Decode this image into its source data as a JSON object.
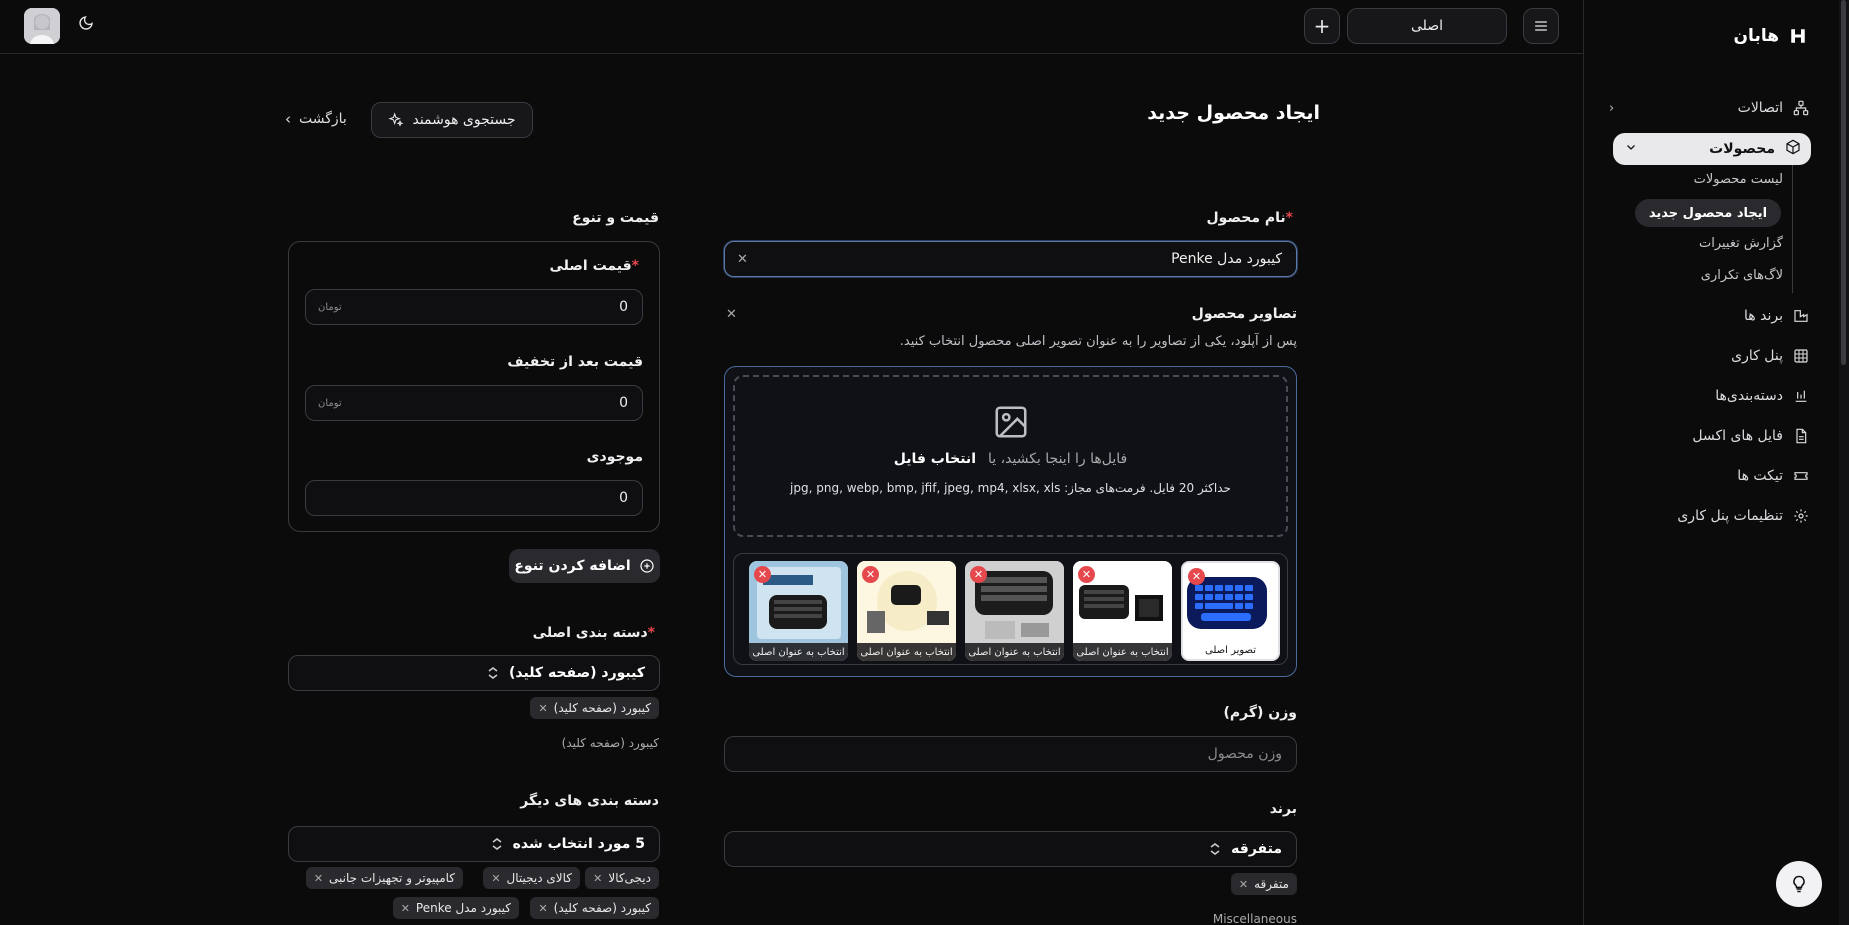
{
  "app": {
    "brand": "هابان"
  },
  "topbar": {
    "workspace": "اصلی"
  },
  "sidebar": {
    "items": [
      {
        "label": "اتصالات"
      },
      {
        "label": "محصولات"
      },
      {
        "label": "برند ها"
      },
      {
        "label": "پنل کاری"
      },
      {
        "label": "دسته‌بندی‌ها"
      },
      {
        "label": "فایل های اکسل"
      },
      {
        "label": "تیکت ها"
      },
      {
        "label": "تنظیمات پنل کاری"
      }
    ],
    "sub_items": [
      {
        "label": "لیست محصولات"
      },
      {
        "label": "ایجاد محصول جدید"
      },
      {
        "label": "گزارش تغییرات"
      },
      {
        "label": "لاگ‌های تکراری"
      }
    ]
  },
  "page": {
    "title": "ایجاد محصول جدید",
    "smart_search": "جستجوی هوشمند",
    "back": "بازگشت"
  },
  "product": {
    "name_label": "نام محصول",
    "name_value": "کیبورد مدل Penke",
    "images_label": "تصاویر محصول",
    "images_hint": "پس از آپلود، یکی از تصاویر را به عنوان تصویر اصلی محصول انتخاب کنید.",
    "drop_text": "فایل‌ها را اینجا بکشید، یا",
    "choose_file": "انتخاب فایل",
    "formats": "حداکثر 20 فایل. فرمت‌های مجاز: jpg, png, webp, bmp, jfif, jpeg, mp4, xlsx, xls",
    "thumbs": [
      {
        "caption": "تصویر اصلی",
        "img": "kbd-blue"
      },
      {
        "caption": "انتخاب به عنوان اصلی",
        "img": "kbd-black-box"
      },
      {
        "caption": "انتخاب به عنوان اصلی",
        "img": "kbd-white-bg"
      },
      {
        "caption": "انتخاب به عنوان اصلی",
        "img": "kbd-round"
      },
      {
        "caption": "انتخاب به عنوان اصلی",
        "img": "kbd-package"
      }
    ],
    "weight_label": "وزن (گرم)",
    "weight_placeholder": "وزن محصول",
    "brand_label": "برند",
    "brand_value": "متفرقه",
    "brand_tag": "متفرقه",
    "brand_en": "Miscellaneous"
  },
  "pricing": {
    "section_label": "قیمت و تنوع",
    "original_price_label": "قیمت اصلی",
    "original_price_value": "0",
    "discount_price_label": "قیمت بعد از تخفیف",
    "discount_price_value": "0",
    "stock_label": "موجودی",
    "stock_value": "0",
    "currency": "تومان",
    "add_variant": "اضافه کردن تنوع"
  },
  "category": {
    "main_label": "دسته بندی اصلی",
    "main_value": "کیبورد (صفحه کلید)",
    "main_tag": "کیبورد (صفحه کلید)",
    "main_path": "کیبورد (صفحه کلید)",
    "other_label": "دسته بندی های دیگر",
    "other_value": "5 مورد انتخاب شده",
    "other_tags": [
      "دیجی‌کالا",
      "کالای دیجیتال",
      "کامپیوتر و تجهیزات جانبی",
      "کیبورد (صفحه کلید)",
      "کیبورد مدل Penke"
    ]
  },
  "colors": {
    "accent": "#e5484d",
    "focus": "#5b7aa8",
    "bg": "#0b0b0c"
  }
}
